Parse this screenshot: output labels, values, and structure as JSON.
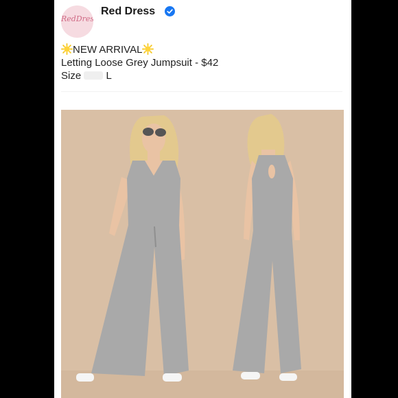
{
  "post": {
    "account_name": "Red Dress",
    "avatar_text": "RedDress",
    "headline": "NEW ARRIVAL",
    "product_line": "Letting Loose Grey Jumpsuit - $42",
    "size_label": "Size",
    "size_value": "L"
  },
  "icons": {
    "verified": "verified-badge-icon",
    "sun": "sun-emoji-icon"
  },
  "colors": {
    "page_background": "#000000",
    "card_background": "#ffffff",
    "photo_background": "#d9bfa5",
    "jumpsuit": "#a9a9a9",
    "verified": "#1877f2"
  }
}
